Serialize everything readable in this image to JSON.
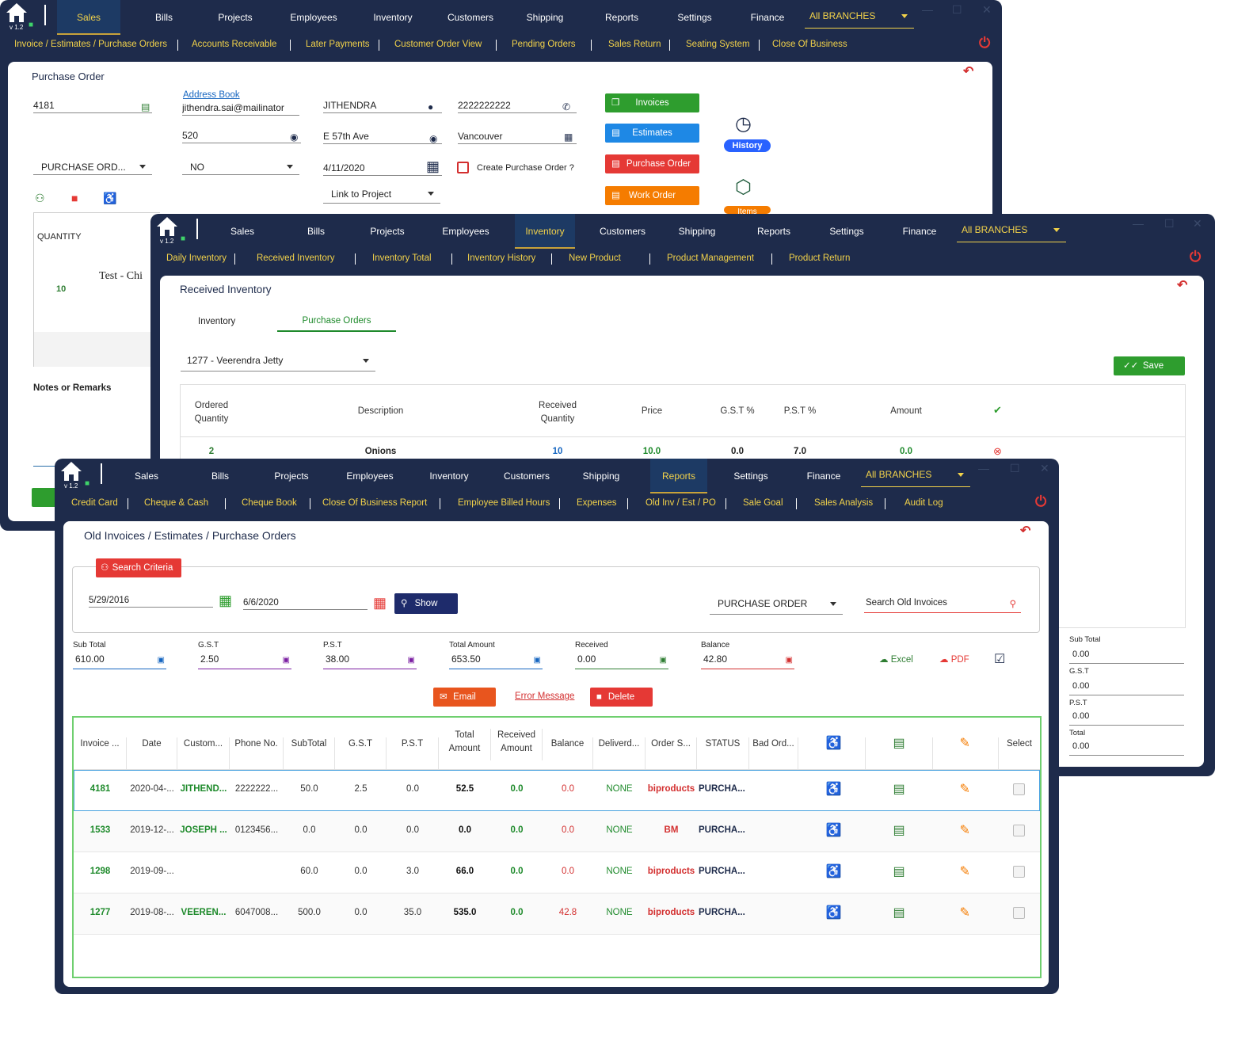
{
  "win1": {
    "version": "v 1.2",
    "nav": [
      "Sales",
      "Bills",
      "Projects",
      "Employees",
      "Inventory",
      "Customers",
      "Shipping",
      "Reports",
      "Settings",
      "Finance"
    ],
    "branch": "All BRANCHES",
    "sub": [
      "Invoice / Estimates / Purchase Orders",
      "Accounts Receivable",
      "Later Payments",
      "Customer Order View",
      "Pending Orders",
      "Sales Return",
      "Seating System",
      "Close Of Business"
    ],
    "title": "Purchase Order",
    "po_number": "4181",
    "address_book": "Address Book",
    "email": "jithendra.sai@mailinator",
    "name": "JITHENDRA",
    "phone": "2222222222",
    "unit": "520",
    "street": "E 57th Ave",
    "city": "Vancouver",
    "type": "PURCHASE ORD...",
    "no": "NO",
    "date": "4/11/2020",
    "create_po": "Create Purchase Order ?",
    "link_project": "Link to Project",
    "btn_invoices": "Invoices",
    "btn_estimates": "Estimates",
    "btn_po": "Purchase Order",
    "btn_wo": "Work Order",
    "history": "History",
    "items": "Items",
    "col_quantity": "QUANTITY",
    "row_qty": "10",
    "row_desc": "Test - Chi",
    "notes": "Notes or Remarks"
  },
  "win2": {
    "version": "v 1.2",
    "nav": [
      "Sales",
      "Bills",
      "Projects",
      "Employees",
      "Inventory",
      "Customers",
      "Shipping",
      "Reports",
      "Settings",
      "Finance"
    ],
    "branch": "All BRANCHES",
    "sub": [
      "Daily Inventory",
      "Received Inventory",
      "Inventory Total",
      "Inventory History",
      "New Product",
      "Product Management",
      "Product Return"
    ],
    "title": "Received Inventory",
    "tab_inventory": "Inventory",
    "tab_po": "Purchase Orders",
    "vendor": "1277 - Veerendra Jetty",
    "save": "Save",
    "headers": [
      "Ordered Quantity",
      "Description",
      "Received Quantity",
      "Price",
      "G.S.T %",
      "P.S.T %",
      "Amount"
    ],
    "row": [
      "2",
      "Onions",
      "10",
      "10.0",
      "0.0",
      "7.0",
      "0.0"
    ],
    "totals": [
      {
        "label": "Sub Total",
        "value": "0.00"
      },
      {
        "label": "G.S.T",
        "value": "0.00"
      },
      {
        "label": "P.S.T",
        "value": "0.00"
      },
      {
        "label": "Total",
        "value": "0.00"
      }
    ]
  },
  "win3": {
    "version": "v 1.2",
    "nav": [
      "Sales",
      "Bills",
      "Projects",
      "Employees",
      "Inventory",
      "Customers",
      "Shipping",
      "Reports",
      "Settings",
      "Finance"
    ],
    "branch": "All BRANCHES",
    "sub": [
      "Credit Card",
      "Cheque & Cash",
      "Cheque Book",
      "Close Of Business Report",
      "Employee Billed Hours",
      "Expenses",
      "Old Inv / Est / PO",
      "Sale Goal",
      "Sales Analysis",
      "Audit Log"
    ],
    "title": "Old Invoices / Estimates / Purchase Orders",
    "search_criteria": "Search Criteria",
    "date_from": "5/29/2016",
    "date_to": "6/6/2020",
    "show": "Show",
    "doc_type": "PURCHASE ORDER",
    "search_placeholder": "Search Old Invoices",
    "summary": [
      {
        "label": "Sub Total",
        "value": "610.00",
        "color": "#1565c0"
      },
      {
        "label": "G.S.T",
        "value": "2.50",
        "color": "#7b1fa2"
      },
      {
        "label": "P.S.T",
        "value": "38.00",
        "color": "#7b1fa2"
      },
      {
        "label": "Total Amount",
        "value": "653.50",
        "color": "#1565c0"
      },
      {
        "label": "Received",
        "value": "0.00",
        "color": "#2e7d32"
      },
      {
        "label": "Balance",
        "value": "42.80",
        "color": "#d32f2f"
      }
    ],
    "excel": "Excel",
    "pdf": "PDF",
    "email": "Email",
    "error_message": "Error Message",
    "delete": "Delete",
    "headers": [
      "Invoice ...",
      "Date",
      "Custom...",
      "Phone No.",
      "SubTotal",
      "G.S.T",
      "P.S.T",
      "Total Amount",
      "Received Amount",
      "Balance",
      "Deliverd...",
      "Order S...",
      "STATUS",
      "Bad Ord...",
      "",
      "",
      "",
      "Select"
    ],
    "rows": [
      [
        "4181",
        "2020-04-...",
        "JITHEND...",
        "2222222...",
        "50.0",
        "2.5",
        "0.0",
        "52.5",
        "0.0",
        "0.0",
        "NONE",
        "biproducts",
        "PURCHA..."
      ],
      [
        "1533",
        "2019-12-...",
        "JOSEPH ...",
        "0123456...",
        "0.0",
        "0.0",
        "0.0",
        "0.0",
        "0.0",
        "0.0",
        "NONE",
        "BM",
        "PURCHA..."
      ],
      [
        "1298",
        "2019-09-...",
        "",
        "",
        "60.0",
        "0.0",
        "3.0",
        "66.0",
        "0.0",
        "0.0",
        "NONE",
        "biproducts",
        "PURCHA..."
      ],
      [
        "1277",
        "2019-08-...",
        "VEEREN...",
        "6047008...",
        "500.0",
        "0.0",
        "35.0",
        "535.0",
        "0.0",
        "42.8",
        "NONE",
        "biproducts",
        "PURCHA..."
      ]
    ]
  }
}
